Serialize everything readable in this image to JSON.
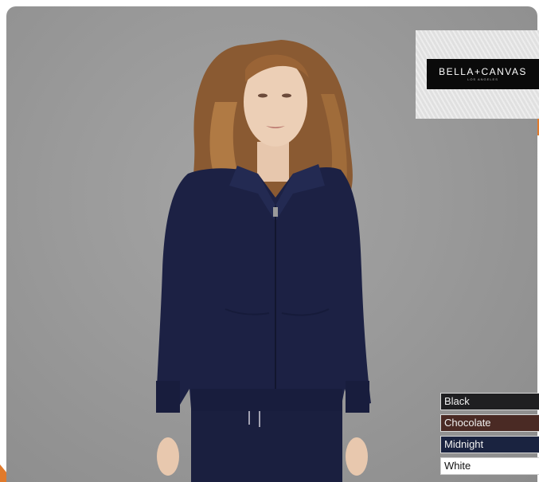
{
  "brand": {
    "logo_main": "BELLA+CANVAS",
    "logo_sub": "LOS ANGELES"
  },
  "product": {
    "image_alt": "Model wearing navy full-zip hoodie"
  },
  "colors": {
    "accent": "#e07a2c",
    "garment": "#1c2144"
  },
  "swatches": [
    {
      "label": "Black",
      "color": "#1f1f21"
    },
    {
      "label": "Chocolate",
      "color": "#4a2a24"
    },
    {
      "label": "Midnight",
      "color": "#1a2340"
    },
    {
      "label": "White",
      "color": "#ffffff"
    }
  ]
}
